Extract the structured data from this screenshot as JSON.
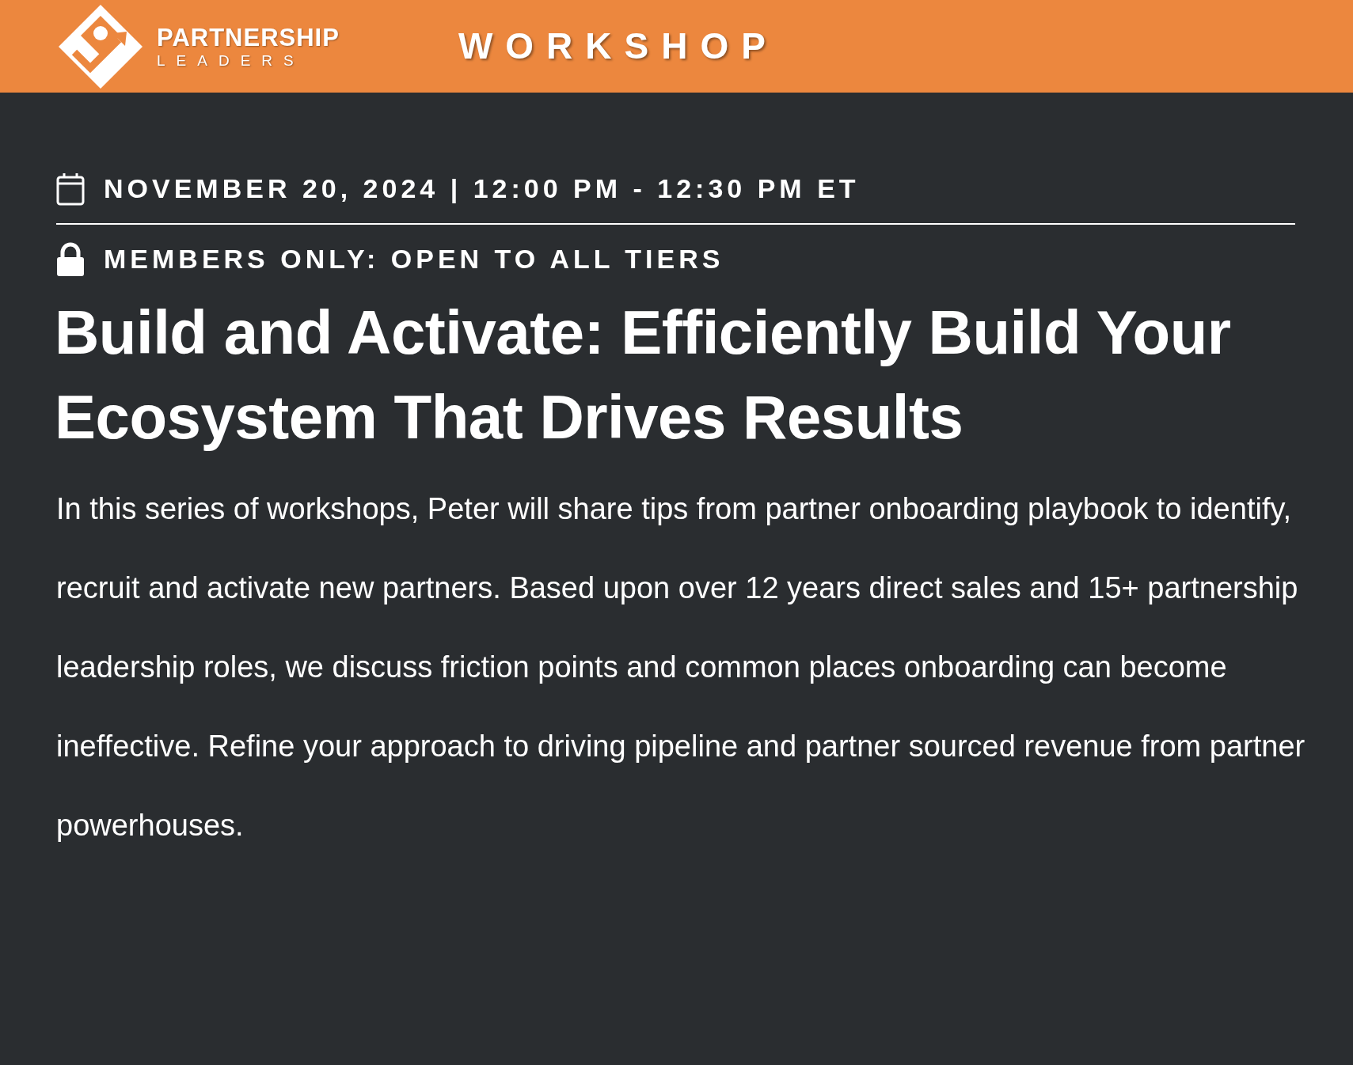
{
  "header": {
    "brand": {
      "name": "PARTNERSHIP",
      "subtitle": "LEADERS"
    },
    "label": "WORKSHOP"
  },
  "event": {
    "date": "NOVEMBER 20, 2024 | 12:00 PM - 12:30 PM ET",
    "access": "MEMBERS ONLY: OPEN TO ALL TIERS",
    "title": "Build and Activate: Efficiently Build Your Ecosystem That Drives Results",
    "description": "In this series of workshops, Peter will share tips from partner onboarding playbook to identify, recruit and activate new partners. Based upon over 12 years direct sales and 15+ partnership leadership roles, we discuss friction points and common places onboarding can become ineffective. Refine your approach to driving pipeline and partner sourced revenue from partner powerhouses."
  }
}
